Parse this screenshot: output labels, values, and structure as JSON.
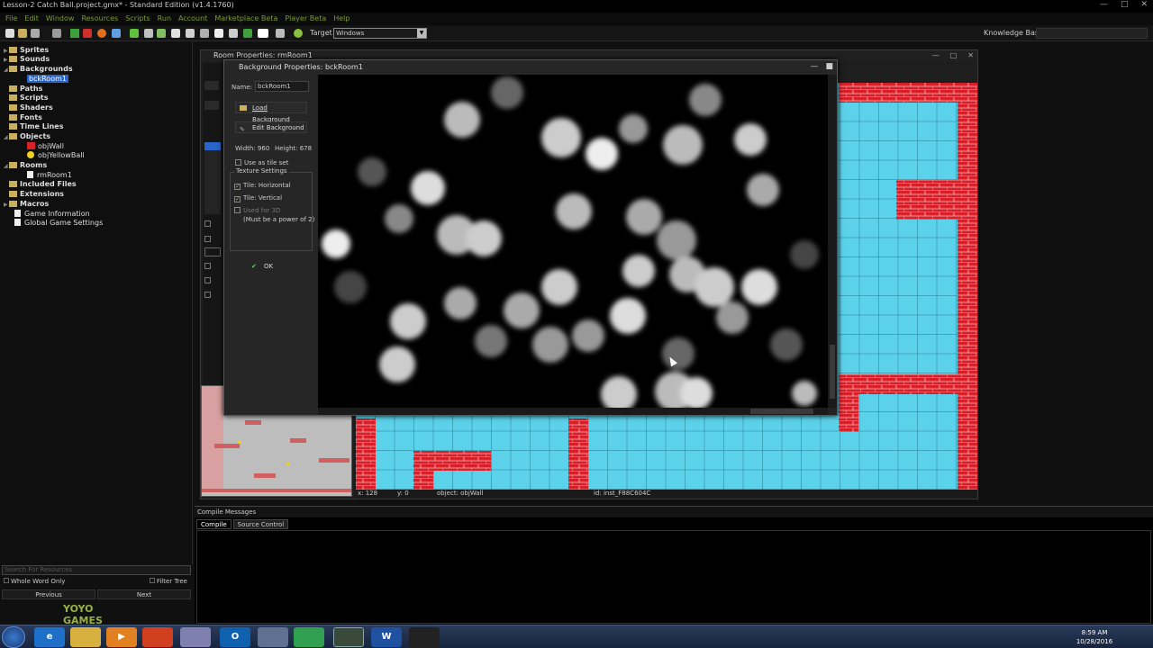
{
  "window": {
    "title": "Lesson-2 Catch Ball.project.gmx* - Standard Edition (v1.4.1760)"
  },
  "menu": [
    "File",
    "Edit",
    "Window",
    "Resources",
    "Scripts",
    "Run",
    "Account",
    "Marketplace Beta",
    "Player Beta",
    "Help"
  ],
  "toolbar": {
    "target_label": "Target",
    "target_value": "Windows",
    "kb_label": "Knowledge Base:"
  },
  "tree": {
    "sprites": "Sprites",
    "sounds": "Sounds",
    "backgrounds": "Backgrounds",
    "bck_room": "bckRoom1",
    "paths": "Paths",
    "scripts": "Scripts",
    "shaders": "Shaders",
    "fonts": "Fonts",
    "timelines": "Time Lines",
    "objects": "Objects",
    "obj_wall": "objWall",
    "obj_ball": "objYellowBall",
    "rooms": "Rooms",
    "rm_room": "rmRoom1",
    "included": "Included Files",
    "extensions": "Extensions",
    "macros": "Macros",
    "game_info": "Game Information",
    "global": "Global Game Settings"
  },
  "search": {
    "placeholder": "Search For Resources",
    "whole_word": "Whole Word Only",
    "filter": "Filter Tree",
    "previous": "Previous",
    "next": "Next"
  },
  "brand": "YOYO GAMES",
  "room": {
    "title": "Room Properties: rmRoom1",
    "status": {
      "x": "x: 128",
      "y": "y: 0",
      "object": "object: objWall",
      "id": "id: inst_F88C604C"
    }
  },
  "bg": {
    "title": "Background Properties: bckRoom1",
    "name_label": "Name:",
    "name_value": "bckRoom1",
    "load": "Load Background",
    "edit": "Edit Background",
    "width": "Width: 960",
    "height": "Height: 678",
    "tile_set": "Use as tile set",
    "texture": "Texture Settings",
    "tile_h": "Tile: Horizontal",
    "tile_v": "Tile: Vertical",
    "used3d": "Used for 3D",
    "power2": "(Must be a power of 2)",
    "ok": "OK"
  },
  "compile": {
    "title": "Compile Messages",
    "tab_compile": "Compile",
    "tab_source": "Source Control"
  },
  "clock": {
    "time": "8:59 AM",
    "date": "10/28/2016"
  },
  "colors": {
    "accent_green": "#7a9a30",
    "selection": "#2b64c8",
    "room_floor": "#5cd2ea",
    "brick": "#d8202a"
  }
}
